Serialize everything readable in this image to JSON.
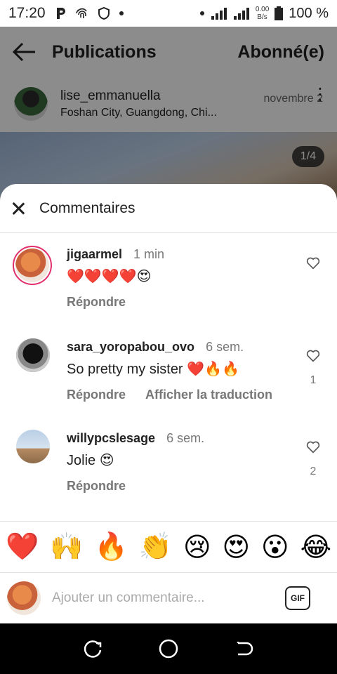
{
  "status_bar": {
    "time": "17:20",
    "speed_value": "0.00",
    "speed_unit": "B/s",
    "battery": "100 %"
  },
  "post": {
    "header_title": "Publications",
    "follow_label": "Abonné(e)",
    "username": "lise_emmanuella",
    "location": "Foshan City, Guangdong, Chi...",
    "date": "novembre 2",
    "image_counter": "1/4"
  },
  "sheet": {
    "title": "Commentaires"
  },
  "comments": [
    {
      "username": "jigaarmel",
      "time": "1 min",
      "text": "❤️❤️❤️❤️😍",
      "reply_label": "Répondre",
      "translate_label": "",
      "likes": ""
    },
    {
      "username": "sara_yoropabou_ovo",
      "time": "6 sem.",
      "text": "So pretty my sister ❤️🔥🔥",
      "reply_label": "Répondre",
      "translate_label": "Afficher la traduction",
      "likes": "1"
    },
    {
      "username": "willypcslesage",
      "time": "6 sem.",
      "text": "Jolie 😍",
      "reply_label": "Répondre",
      "translate_label": "",
      "likes": "2"
    }
  ],
  "quick_emojis": [
    "❤️",
    "🙌",
    "🔥",
    "👏",
    "😢",
    "😍",
    "😮",
    "😂"
  ],
  "composer": {
    "placeholder": "Ajouter un commentaire...",
    "gif_label": "GIF"
  },
  "colors": {
    "ring": "#e1306c",
    "text": "#222222",
    "muted": "#777777"
  }
}
